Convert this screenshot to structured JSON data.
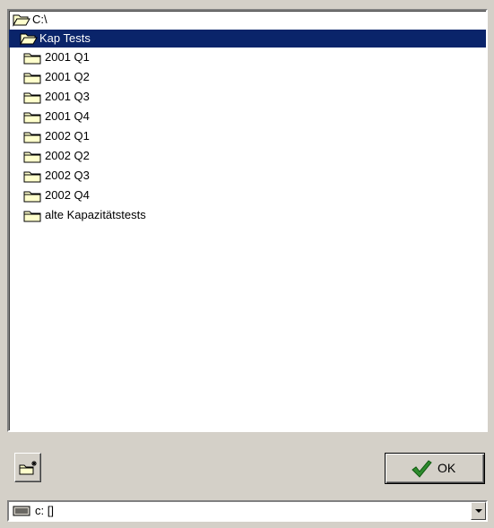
{
  "tree": {
    "root": {
      "label": "C:\\",
      "icon": "open-folder-icon"
    },
    "current": {
      "label": "Kap Tests",
      "icon": "open-folder-icon"
    },
    "subfolders": [
      {
        "label": "2001 Q1",
        "icon": "folder-icon"
      },
      {
        "label": "2001 Q2",
        "icon": "folder-icon"
      },
      {
        "label": "2001 Q3",
        "icon": "folder-icon"
      },
      {
        "label": "2001 Q4",
        "icon": "folder-icon"
      },
      {
        "label": "2002 Q1",
        "icon": "folder-icon"
      },
      {
        "label": "2002 Q2",
        "icon": "folder-icon"
      },
      {
        "label": "2002 Q3",
        "icon": "folder-icon"
      },
      {
        "label": "2002 Q4",
        "icon": "folder-icon"
      },
      {
        "label": "alte Kapazitätstests",
        "icon": "folder-icon"
      }
    ]
  },
  "buttons": {
    "new_folder_icon": "new-folder-icon",
    "ok_label": "OK",
    "ok_icon": "checkmark-icon"
  },
  "drive": {
    "label": "c: []",
    "icon": "drive-icon"
  },
  "colors": {
    "selection": "#0a246a",
    "folder_fill": "#ffffcc",
    "check_green": "#2e8b2e"
  }
}
